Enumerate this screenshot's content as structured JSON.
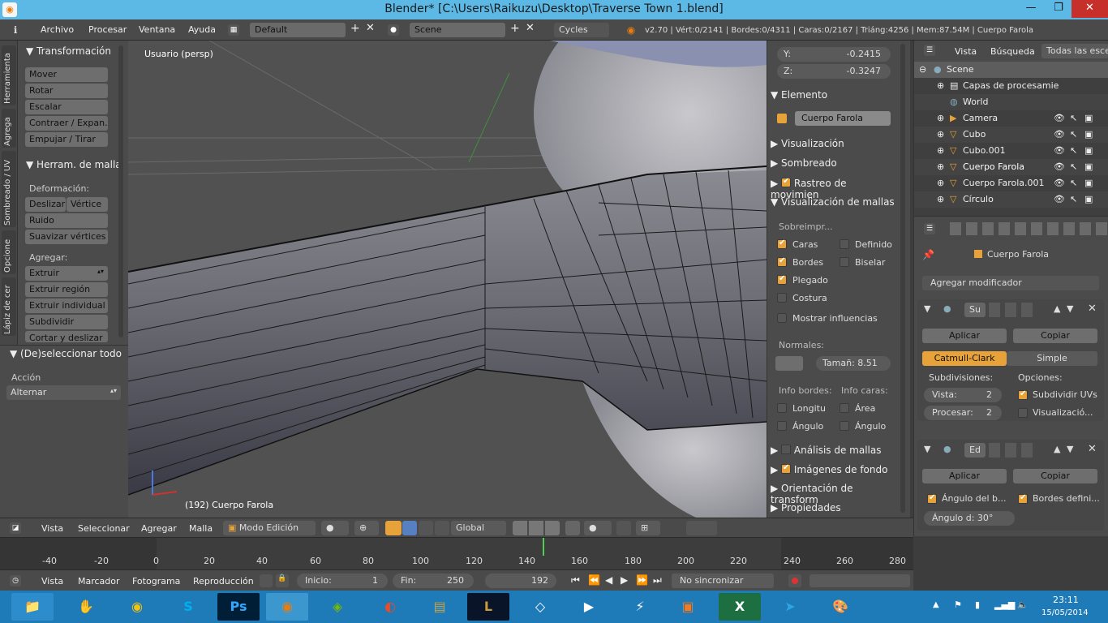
{
  "window": {
    "title": "Blender* [C:\\Users\\Raikuzu\\Desktop\\Traverse Town 1.blend]",
    "minimize": "—",
    "maximize": "❐",
    "close": "✕"
  },
  "menubar": {
    "info_icon": "ℹ",
    "menus": [
      "Archivo",
      "Procesar",
      "Ventana",
      "Ayuda"
    ],
    "screen_layout": "Default",
    "scene": "Scene",
    "renderer": "Cycles",
    "status": "v2.70 | Vért:0/2141 | Bordes:0/4311 | Caras:0/2167 | Triáng:4256 | Mem:87.54M | Cuerpo Farola"
  },
  "left_tabs": [
    "Herramienta",
    "Agrega",
    "Sombreado / UV",
    "Opcione",
    "Lápiz de cer"
  ],
  "tool_shelf": {
    "transform_header": "Transformación",
    "transform_buttons": [
      "Mover",
      "Rotar",
      "Escalar",
      "Contraer / Expan...",
      "Empujar / Tirar"
    ],
    "mesh_tools_header": "Herram. de malla",
    "deform_label": "Deformación:",
    "slide_label": "Deslizar",
    "vertex_label": "Vértice",
    "deform_buttons": [
      "Ruido",
      "Suavizar vértices"
    ],
    "add_label": "Agregar:",
    "extrude": "Extruir",
    "add_buttons": [
      "Extruir región",
      "Extruir individual",
      "Subdividir",
      "Cortar y deslizar"
    ]
  },
  "operator_panel": {
    "header": "(De)seleccionar todo",
    "action_label": "Acción",
    "action_value": "Alternar"
  },
  "viewport": {
    "view_label": "Usuario (persp)",
    "object_label": "(192) Cuerpo Farola"
  },
  "n_panel": {
    "y_label": "Y:",
    "y_value": "-0.2415",
    "z_label": "Z:",
    "z_value": "-0.3247",
    "item_header": "Elemento",
    "item_name": "Cuerpo Farola",
    "sections": [
      "Visualización",
      "Sombreado",
      "Rastreo de movimien",
      "Visualización de mallas"
    ],
    "overlay_label": "Sobreimpr...",
    "overlays_left": [
      {
        "label": "Caras",
        "on": true
      },
      {
        "label": "Bordes",
        "on": true
      },
      {
        "label": "Plegado",
        "on": true
      },
      {
        "label": "Costura",
        "on": false
      }
    ],
    "overlays_right": [
      {
        "label": "Definido",
        "on": false
      },
      {
        "label": "Biselar",
        "on": false
      }
    ],
    "weights": "Mostrar influencias",
    "normals_label": "Normales:",
    "normals_size": "Tamañ: 8.51",
    "edge_info": "Info bordes:",
    "face_info": "Info caras:",
    "length": "Longitu",
    "area": "Área",
    "angle_e": "Ángulo",
    "angle_f": "Ángulo",
    "bottom_sections": [
      "Análisis de mallas",
      "Imágenes de fondo",
      "Orientación de transform",
      "Propiedades"
    ]
  },
  "outliner": {
    "menus": [
      "Vista",
      "Búsqueda",
      "Todas las escen"
    ],
    "rows": [
      "Scene",
      "Capas de procesamie",
      "World",
      "Camera",
      "Cubo",
      "Cubo.001",
      "Cuerpo Farola",
      "Cuerpo Farola.001",
      "Círculo"
    ]
  },
  "properties": {
    "object_name": "Cuerpo Farola",
    "add_modifier": "Agregar modificador",
    "mod1_name": "Su",
    "apply": "Aplicar",
    "copy": "Copiar",
    "catmull": "Catmull-Clark",
    "simple": "Simple",
    "subdiv_label": "Subdivisiones:",
    "options_label": "Opciones:",
    "view_levels": "Vista:",
    "view_levels_value": "2",
    "render_levels": "Procesar:",
    "render_levels_value": "2",
    "subdiv_uvs": "Subdividir UVs",
    "optimal_display": "Visualizació...",
    "mod2_name": "Ed",
    "edge_angle": "Ángulo del b...",
    "sharp_edges": "Bordes defini...",
    "angle_field": "Ángulo d: 30°"
  },
  "view3d_header": {
    "menus": [
      "Vista",
      "Seleccionar",
      "Agregar",
      "Malla"
    ],
    "mode": "Modo Edición",
    "orientation": "Global"
  },
  "timeline": {
    "ticks": [
      "-40",
      "-20",
      "0",
      "20",
      "40",
      "60",
      "80",
      "100",
      "120",
      "140",
      "160",
      "180",
      "200",
      "220",
      "240",
      "260",
      "280"
    ],
    "current_frame_pct": 0.594,
    "menus": [
      "Vista",
      "Marcador",
      "Fotograma",
      "Reproducción"
    ],
    "start": "Inicio:",
    "start_value": "1",
    "end": "Fin:",
    "end_value": "250",
    "frame": "192",
    "sync": "No sincronizar"
  },
  "taskbar": {
    "clock_time": "23:11",
    "clock_date": "15/05/2014"
  },
  "colors": {
    "accent": "#e8a23a",
    "selected_blue": "#5680c2",
    "taskbar": "#1e7bb8"
  }
}
